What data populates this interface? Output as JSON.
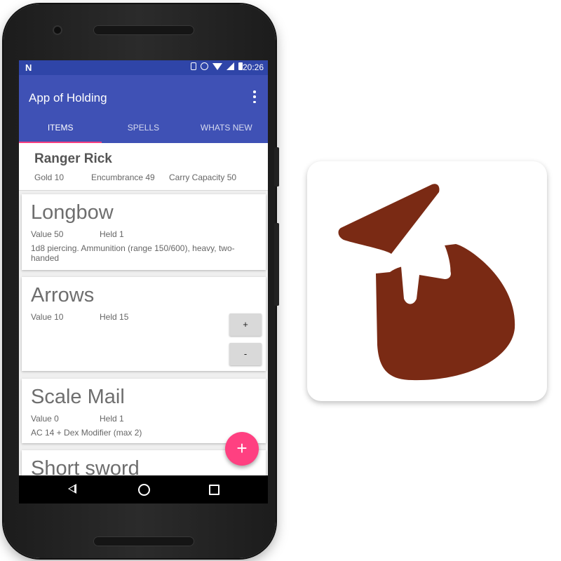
{
  "status_bar": {
    "notification_icon": "N",
    "time": "20:26",
    "icons": [
      "vibrate-icon",
      "alarm-icon",
      "wifi-icon",
      "signal-icon",
      "battery-icon"
    ]
  },
  "app_bar": {
    "title": "App of Holding",
    "overflow_icon": "more-vert-icon",
    "tabs": [
      "ITEMS",
      "SPELLS",
      "WHATS NEW"
    ],
    "active_tab": "ITEMS"
  },
  "character": {
    "name": "Ranger Rick",
    "gold": "Gold 10",
    "encumbrance": "Encumbrance 49",
    "carry_capacity": "Carry Capacity 50"
  },
  "items": [
    {
      "name": "Longbow",
      "value": "Value 50",
      "held": "Held 1",
      "description": "1d8 piercing. Ammunition (range 150/600), heavy, two-handed"
    },
    {
      "name": "Arrows",
      "value": "Value 10",
      "held": "Held 15",
      "description": "",
      "increment_label": "+",
      "decrement_label": "-"
    },
    {
      "name": "Scale Mail",
      "value": "Value 0",
      "held": "Held 1",
      "description": "AC 14 + Dex Modifier (max 2)"
    },
    {
      "name": "Short sword"
    }
  ],
  "fab_label": "+",
  "colors": {
    "primary": "#3f51b5",
    "primary_dark": "#2f45a8",
    "accent": "#ff4081",
    "icon_bag": "#7a2a14"
  },
  "app_icon": "bag-of-holding-icon"
}
